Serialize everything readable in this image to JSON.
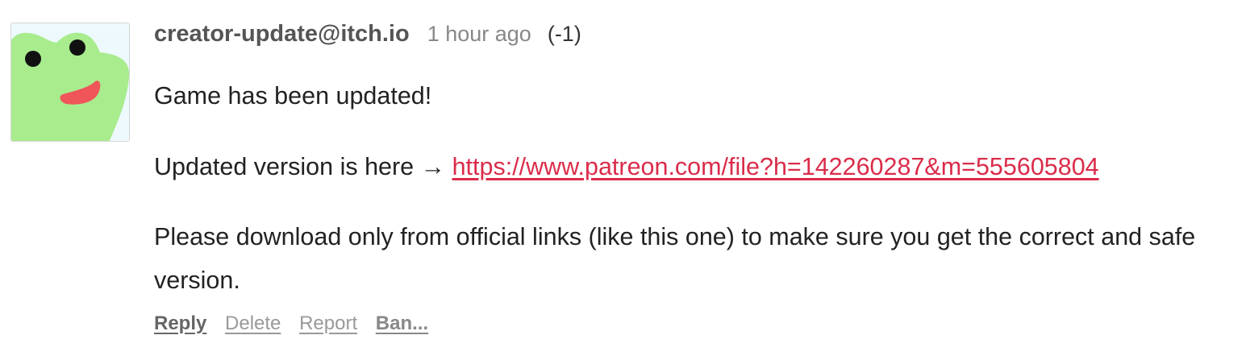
{
  "comment": {
    "avatar": {
      "icon": "frog-face-icon",
      "colors": {
        "background": "#eef9fd",
        "skin": "#a8ec8e",
        "mouth": "#f0555a",
        "eyes": "#111111"
      }
    },
    "author": "creator-update@itch.io",
    "timestamp": "1 hour ago",
    "vote_score": "(-1)",
    "body": {
      "line1": "Game has been updated!",
      "line2_prefix": "Updated version is here →",
      "link_text": "https://www.patreon.com/file?h=142260287&m=555605804",
      "line3": "Please download only from official links (like this one) to make sure you get the correct and safe version."
    },
    "actions": {
      "reply": "Reply",
      "delete": "Delete",
      "report": "Report",
      "ban": "Ban..."
    },
    "colors": {
      "link": "#da2c4a",
      "author": "#555555",
      "muted": "#888888"
    }
  }
}
